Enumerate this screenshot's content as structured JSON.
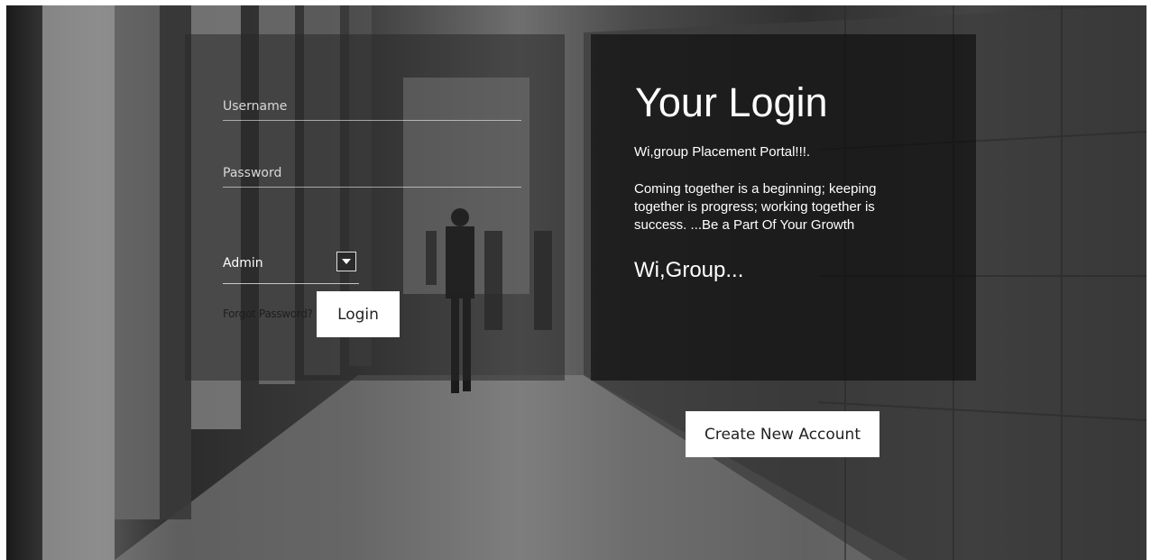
{
  "login_form": {
    "username_placeholder": "Username",
    "password_placeholder": "Password",
    "role_select": {
      "selected": "Admin",
      "options": [
        "Admin"
      ]
    },
    "forgot_password_label": "Forgot Password?",
    "login_label": "Login"
  },
  "info_panel": {
    "title": "Your Login",
    "subtitle": "Wi,group Placement Portal!!!.",
    "quote": "Coming together is a beginning; keeping together is progress; working together is success. ...Be a Part Of Your Growth",
    "brand": "Wi,Group..."
  },
  "create_account_label": "Create New Account",
  "icons": {
    "select_arrow": "chevron-down-icon"
  }
}
